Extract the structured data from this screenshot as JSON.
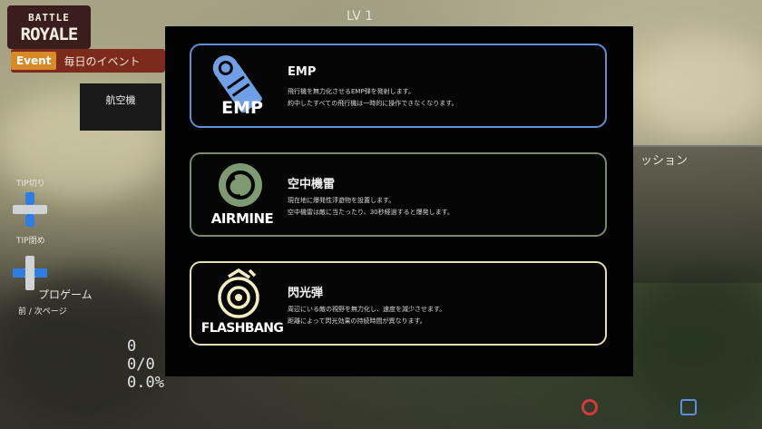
{
  "hud": {
    "logo_line1": "BATTLE",
    "logo_line2": "ROYALE",
    "event_tag": "Event",
    "event_text": "毎日のイベント",
    "level_text": "LV 1",
    "side_card_title": "航空機",
    "tip_top": "TIP切り",
    "tip_mid": "TIP閉め",
    "nav_label": "プロゲーム",
    "nav_sub": "前 / 次ページ",
    "right_panel_title": "ッション",
    "stats_values": [
      "0",
      "0/0",
      "0.0%"
    ]
  },
  "modal": {
    "items": [
      {
        "name": "EMP",
        "icon_label": "EMP",
        "icon": "emp-icon",
        "desc1": "飛行機を無力化させるEMP弾を発射します。",
        "desc2": "約中したすべての飛行機は一時的に操作できなくなります。",
        "border_color": "#5f8fd6",
        "icon_color": "#6fa0e6"
      },
      {
        "name": "空中機雷",
        "icon_label": "AIRMINE",
        "icon": "airmine-icon",
        "desc1": "現在地に爆発性浮遊物を設置します。",
        "desc2": "空中機雷は敵に当たったり、30秒経過すると爆発します。",
        "border_color": "#7c8a6e",
        "icon_color": "#7f9a72"
      },
      {
        "name": "閃光弾",
        "icon_label": "FLASHBANG",
        "icon": "flashbang-icon",
        "desc1": "周辺にいる敵の視野を無力化し、速度を減少させます。",
        "desc2": "距離によって閃光効果の持続時間が異なります。",
        "border_color": "#e6dfae",
        "icon_color": "#f3edc2"
      }
    ]
  }
}
